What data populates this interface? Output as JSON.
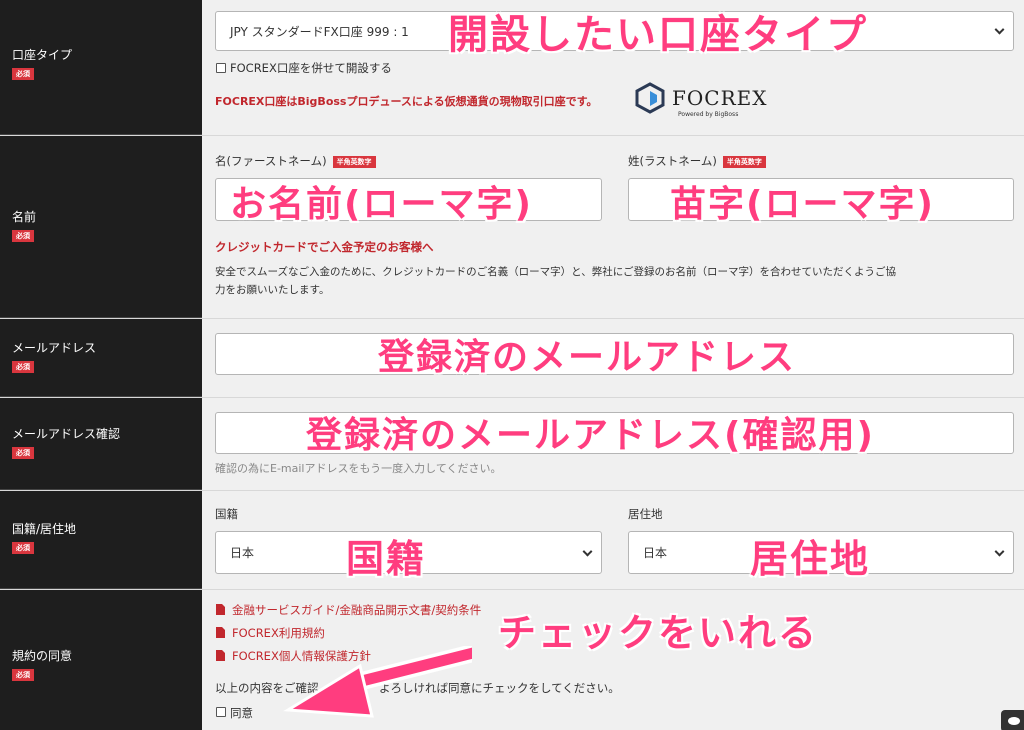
{
  "account_type": {
    "label": "口座タイプ",
    "required": "必須",
    "select_value": "JPY スタンダードFX口座 999 : 1",
    "focrex_checkbox": "FOCREX口座を併せて開設する",
    "focrex_note": "FOCREX口座はBigBossプロデュースによる仮想通貨の現物取引口座です。",
    "logo_text": "FOCREX",
    "logo_sub": "Powered by BigBoss",
    "overlay": "開設したい口座タイプ"
  },
  "name": {
    "label": "名前",
    "required": "必須",
    "first_label": "名(ファーストネーム)",
    "last_label": "姓(ラストネーム)",
    "badge": "半角英数字",
    "first_overlay": "お名前(ローマ字)",
    "last_overlay": "苗字(ローマ字)",
    "card_note_title": "クレジットカードでご入金予定のお客様へ",
    "card_note_line1": "安全でスムーズなご入金のために、クレジットカードのご名義（ローマ字）と、弊社にご登録のお名前（ローマ字）を合わせていただくようご協",
    "card_note_line2": "力をお願いいたします。"
  },
  "email": {
    "label": "メールアドレス",
    "required": "必須",
    "overlay": "登録済のメールアドレス"
  },
  "email_confirm": {
    "label": "メールアドレス確認",
    "required": "必須",
    "overlay": "登録済のメールアドレス(確認用)",
    "hint": "確認の為にE-mailアドレスをもう一度入力してください。"
  },
  "nationality": {
    "label": "国籍/居住地",
    "required": "必須",
    "nationality_label": "国籍",
    "residence_label": "居住地",
    "nationality_value": "日本",
    "residence_value": "日本",
    "nationality_overlay": "国籍",
    "residence_overlay": "居住地"
  },
  "terms": {
    "label": "規約の同意",
    "required": "必須",
    "links": [
      "金融サービスガイド/金融商品開示文書/契約条件",
      "FOCREX利用規約",
      "FOCREX個人情報保護方針"
    ],
    "overlay": "チェックをいれる",
    "confirm_text": "以上の内容をご確認",
    "confirm_text_tail": "よろしければ同意にチェックをしてください。",
    "agree_label": "同意"
  },
  "colors": {
    "overlay": "#ff3d7f",
    "accent": "#c1272d",
    "sidebar": "#1e1e1e"
  }
}
